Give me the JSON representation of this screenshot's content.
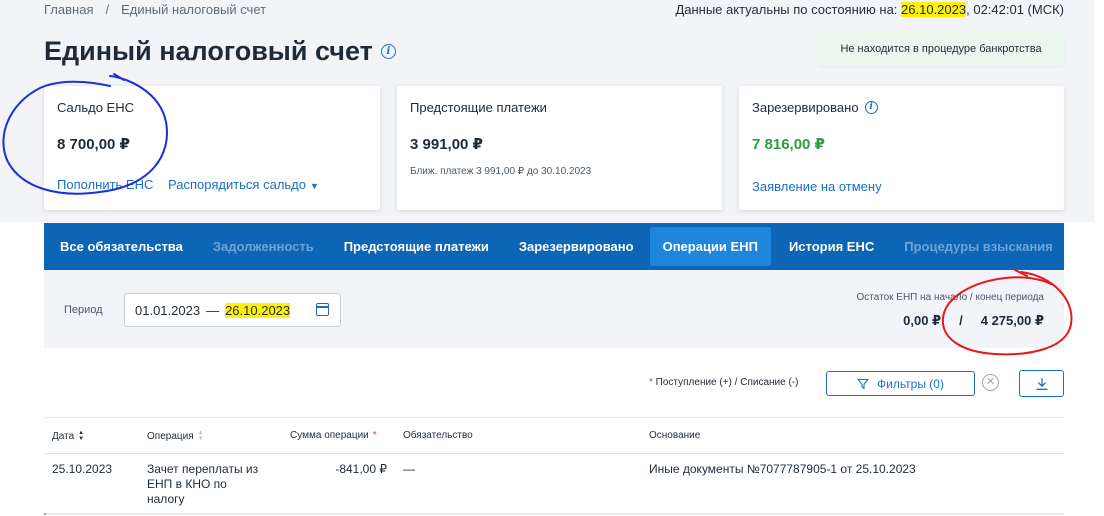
{
  "breadcrumb": {
    "home": "Главная",
    "separator": "/",
    "current": "Единый налоговый счет"
  },
  "freshness": {
    "prefix": "Данные актуальны по состоянию на: ",
    "date": "26.10.2023",
    "time": ", 02:42:01 (МСК)"
  },
  "page": {
    "title": "Единый налоговый счет"
  },
  "bankruptcy_status": "Не находится в процедуре банкротства",
  "cards": {
    "saldo": {
      "label": "Сальдо ЕНС",
      "amount": "8 700,00 ₽",
      "topup_link": "Пополнить ЕНС",
      "dispose_link": "Распорядиться сальдо"
    },
    "upcoming": {
      "label": "Предстоящие платежи",
      "amount": "3 991,00 ₽",
      "note": "Ближ. платеж 3 991,00 ₽ до 30.10.2023"
    },
    "reserved": {
      "label": "Зарезервировано",
      "amount": "7 816,00 ₽",
      "cancel_link": "Заявление на отмену"
    }
  },
  "tabs": [
    {
      "label": "Все обязательства",
      "state": "normal"
    },
    {
      "label": "Задолженность",
      "state": "disabled"
    },
    {
      "label": "Предстоящие платежи",
      "state": "normal"
    },
    {
      "label": "Зарезервировано",
      "state": "normal"
    },
    {
      "label": "Операции ЕНП",
      "state": "active"
    },
    {
      "label": "История ЕНС",
      "state": "normal"
    },
    {
      "label": "Процедуры взыскания",
      "state": "disabled"
    }
  ],
  "filter": {
    "period_label": "Период",
    "date_from": "01.01.2023",
    "date_sep": "—",
    "date_to": "26.10.2023",
    "balance_label": "Остаток ЕНП на начало / конец периода",
    "balance_start": "0,00 ₽",
    "balance_sep": "/",
    "balance_end": "4 275,00 ₽"
  },
  "toolbar": {
    "legend_star": "*",
    "legend_text": " Поступление (+) / Списание (-)",
    "filters_label": "Фильтры (0)",
    "clear_symbol": "✕"
  },
  "table": {
    "headers": {
      "date": "Дата",
      "operation": "Операция",
      "amount": "Сумма операции",
      "amount_star": "*",
      "obligation": "Обязательство",
      "basis": "Основание"
    },
    "rows": [
      {
        "date": "25.10.2023",
        "operation": "Зачет переплаты из ЕНП в КНО по налогу",
        "amount": "-841,00 ₽",
        "obligation": "—",
        "basis": "Иные документы №7077787905-1 от 25.10.2023"
      }
    ]
  },
  "colors": {
    "accent_blue": "#0c65b5",
    "active_tab": "#1e86dc",
    "link_blue": "#1a6fc4",
    "positive_green": "#2a9d3c",
    "highlight_yellow": "#fff200",
    "annotation_blue": "#1f2fd6",
    "annotation_red": "#e8181f"
  }
}
